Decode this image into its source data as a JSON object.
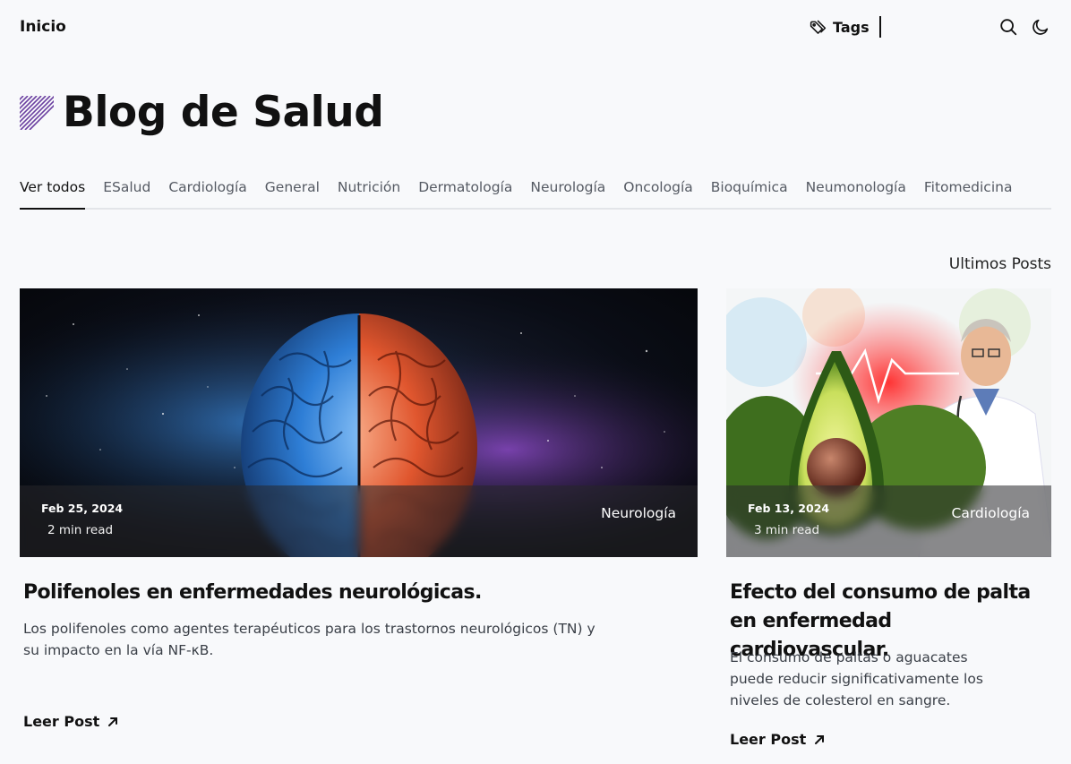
{
  "header": {
    "brand": "Inicio",
    "tags_label": "Tags"
  },
  "hero": {
    "title": "Blog de Salud",
    "accent_color": "#6b3fa0"
  },
  "tabs": [
    {
      "label": "Ver todos",
      "active": true
    },
    {
      "label": "ESalud"
    },
    {
      "label": "Cardiología"
    },
    {
      "label": "General"
    },
    {
      "label": "Nutrición"
    },
    {
      "label": "Dermatología"
    },
    {
      "label": "Neurología"
    },
    {
      "label": "Oncología"
    },
    {
      "label": "Bioquímica"
    },
    {
      "label": "Neumonología"
    },
    {
      "label": "Fitomedicina"
    }
  ],
  "latest": {
    "section_title": "Ultimos Posts",
    "posts": [
      {
        "date": "Feb 25, 2024",
        "read_time": "2 min read",
        "category": "Neurología",
        "title": "Polifenoles en enfermedades neurológicas.",
        "description": "Los polifenoles como agentes terapéuticos para los trastornos neurológicos (TN) y su impacto en la vía NF-κB.",
        "cta": "Leer Post",
        "image": "brain-illustration"
      },
      {
        "date": "Feb 13, 2024",
        "read_time": "3 min read",
        "category": "Cardiología",
        "title": "Efecto del consumo de palta en enfermedad cardiovascular.",
        "description": "El consumo de paltas o aguacates puede reducir significativamente los niveles de colesterol en sangre.",
        "cta": "Leer Post",
        "image": "avocado-doctor-illustration"
      }
    ]
  }
}
